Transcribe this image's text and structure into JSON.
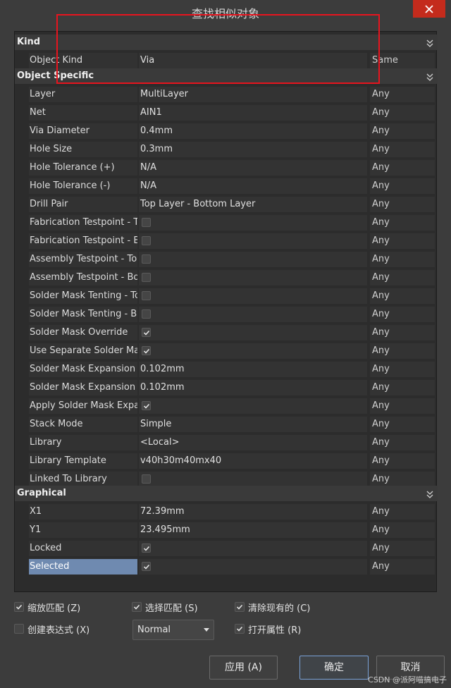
{
  "dialog": {
    "title": "查找相似对象",
    "close_icon": "close-icon"
  },
  "sections": {
    "kind": "Kind",
    "object_specific": "Object Specific",
    "graphical": "Graphical"
  },
  "kind_rows": [
    {
      "name": "Object Kind",
      "value": "Via",
      "match": "Same"
    }
  ],
  "object_rows": [
    {
      "name": "Layer",
      "value": "MultiLayer",
      "match": "Any"
    },
    {
      "name": "Net",
      "value": "AIN1",
      "match": "Any"
    },
    {
      "name": "Via Diameter",
      "value": "0.4mm",
      "match": "Any"
    },
    {
      "name": "Hole Size",
      "value": "0.3mm",
      "match": "Any"
    },
    {
      "name": "Hole Tolerance (+)",
      "value": "N/A",
      "match": "Any"
    },
    {
      "name": "Hole Tolerance (-)",
      "value": "N/A",
      "match": "Any"
    },
    {
      "name": "Drill Pair",
      "value": "Top Layer - Bottom Layer",
      "match": "Any"
    },
    {
      "name": "Fabrication Testpoint - To",
      "checked": false,
      "match": "Any"
    },
    {
      "name": "Fabrication Testpoint - Bo",
      "checked": false,
      "match": "Any"
    },
    {
      "name": "Assembly Testpoint - Top",
      "checked": false,
      "match": "Any"
    },
    {
      "name": "Assembly Testpoint - Bot",
      "checked": false,
      "match": "Any"
    },
    {
      "name": "Solder Mask Tenting - To",
      "checked": false,
      "match": "Any"
    },
    {
      "name": "Solder Mask Tenting - Bo",
      "checked": false,
      "match": "Any"
    },
    {
      "name": "Solder Mask Override",
      "checked": true,
      "match": "Any"
    },
    {
      "name": "Use Separate Solder Mas",
      "checked": true,
      "match": "Any"
    },
    {
      "name": "Solder Mask Expansion - ",
      "value": "0.102mm",
      "match": "Any"
    },
    {
      "name": "Solder Mask Expansion - ",
      "value": "0.102mm",
      "match": "Any"
    },
    {
      "name": "Apply Solder Mask Expan",
      "checked": true,
      "match": "Any"
    },
    {
      "name": "Stack Mode",
      "value": "Simple",
      "match": "Any"
    },
    {
      "name": "Library",
      "value": "<Local>",
      "match": "Any"
    },
    {
      "name": "Library Template",
      "value": "v40h30m40mx40",
      "match": "Any"
    },
    {
      "name": "Linked To Library",
      "checked": false,
      "match": "Any"
    }
  ],
  "graphical_rows": [
    {
      "name": "X1",
      "value": "72.39mm",
      "match": "Any"
    },
    {
      "name": "Y1",
      "value": "23.495mm",
      "match": "Any"
    },
    {
      "name": "Locked",
      "checked": true,
      "match": "Any"
    },
    {
      "name": "Selected",
      "checked": true,
      "match": "Any",
      "selected": true
    }
  ],
  "options": {
    "zoom_match": {
      "label": "缩放匹配 (Z)",
      "checked": true
    },
    "select_match": {
      "label": "选择匹配 (S)",
      "checked": true
    },
    "clear_existing": {
      "label": "清除现有的 (C)",
      "checked": true
    },
    "create_expression": {
      "label": "创建表达式 (X)",
      "checked": false
    },
    "open_properties": {
      "label": "打开属性 (R)",
      "checked": true
    },
    "mode_select": {
      "value": "Normal"
    }
  },
  "buttons": {
    "apply": "应用 (A)",
    "ok": "确定",
    "cancel": "取消"
  },
  "watermark": "CSDN @派阿喵搞电子",
  "colors": {
    "highlight": "#e8141e",
    "selected_row": "#6f8ab0",
    "close": "#c42b1c"
  }
}
